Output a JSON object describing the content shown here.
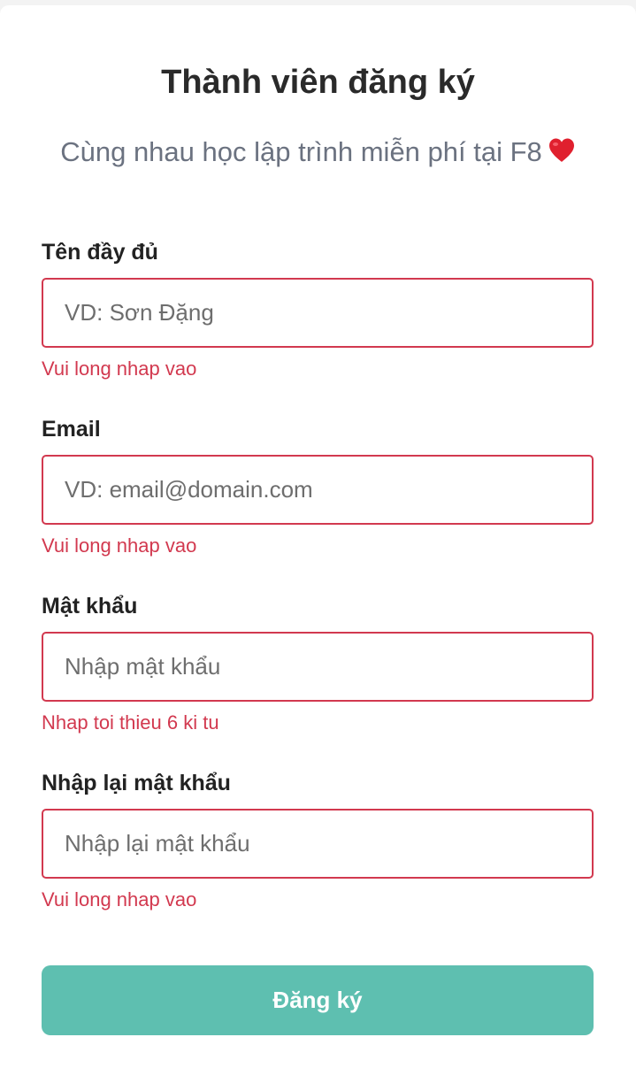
{
  "form": {
    "title": "Thành viên đăng ký",
    "subtitle": "Cùng nhau học lập trình miễn phí tại F8",
    "subtitle_icon": "red-heart-icon",
    "fields": [
      {
        "label": "Tên đầy đủ",
        "placeholder": "VD: Sơn Đặng",
        "value": "",
        "error": "Vui long nhap vao"
      },
      {
        "label": "Email",
        "placeholder": "VD: email@domain.com",
        "value": "",
        "error": "Vui long nhap vao"
      },
      {
        "label": "Mật khẩu",
        "placeholder": "Nhập mật khẩu",
        "value": "",
        "error": "Nhap toi thieu 6 ki tu"
      },
      {
        "label": "Nhập lại mật khẩu",
        "placeholder": "Nhập lại mật khẩu",
        "value": "",
        "error": "Vui long nhap vao"
      }
    ],
    "submit_label": "Đăng ký"
  },
  "colors": {
    "error": "#d2394f",
    "button": "#5ebfb0",
    "title": "#2a2a2a",
    "subtitle": "#6b7280"
  }
}
